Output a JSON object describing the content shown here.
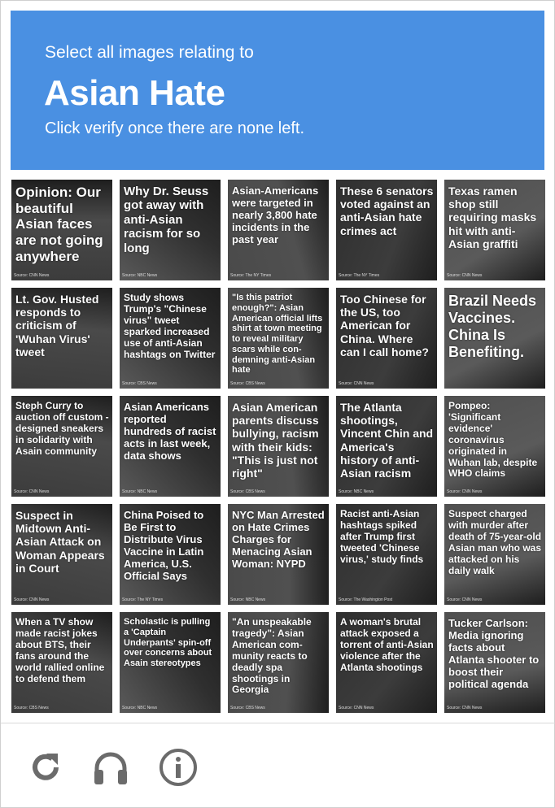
{
  "header": {
    "pre": "Select all images relating to",
    "topic": "Asian Hate",
    "post": "Click verify once there are none left."
  },
  "tiles": [
    {
      "headline": "Opinion: Our beautiful Asian faces are not going anywhere",
      "source": "Source: CNN News",
      "size": 17
    },
    {
      "headline": "Why Dr. Seuss got away with anti-Asian racism for so long",
      "source": "Source: NBC News",
      "size": 15
    },
    {
      "headline": "Asian-Americans were targeted in nearly 3,800 hate incidents in the past year",
      "source": "Source: The NY Times",
      "size": 13
    },
    {
      "headline": "These 6 senators voted against an anti-Asian hate crimes act",
      "source": "Source: The NY Times",
      "size": 14
    },
    {
      "headline": "Texas ramen shop still requiring masks hit with anti-Asian graffiti",
      "source": "Source: CNN News",
      "size": 14
    },
    {
      "headline": "Lt. Gov. Husted responds to criticism of 'Wuhan Virus' tweet",
      "source": "",
      "size": 14
    },
    {
      "headline": "Study shows Trump's \"Chinese virus\" tweet sparked increased use of anti-Asian hashtags on Twitter",
      "source": "Source: CBS News",
      "size": 12
    },
    {
      "headline": "\"Is this patriot enough?\": Asian American official lifts shirt at town meeting to reveal military scars while con-demning anti-Asian hate",
      "source": "Source: CBS News",
      "size": 11
    },
    {
      "headline": "Too Chinese for the US, too American for China. Where can I call home?",
      "source": "Source: CNN News",
      "size": 14
    },
    {
      "headline": "Brazil Needs Vaccines. China Is Benefiting.",
      "source": "",
      "size": 18
    },
    {
      "headline": "Steph Curry to auction off custom -designed sneakers in solidarity with Asain community",
      "source": "Source: CNN News",
      "size": 12
    },
    {
      "headline": "Asian Americans reported hundreds of racist acts in last week, data shows",
      "source": "Source: NBC News",
      "size": 13
    },
    {
      "headline": "Asian American parents discuss bullying, racism with their kids: \"This is just not right\"",
      "source": "Source: CBS News",
      "size": 14
    },
    {
      "headline": "The Atlanta shootings, Vincent Chin and America's history of anti-Asian racism",
      "source": "Source: NBC News",
      "size": 14
    },
    {
      "headline": "Pompeo: 'Significant evidence' coronavirus originated in Wuhan lab, despite WHO claims",
      "source": "Source: CNN News",
      "size": 12
    },
    {
      "headline": "Suspect in Midtown Anti-Asian Attack on Woman Appears in Court",
      "source": "Source: CNN News",
      "size": 14
    },
    {
      "headline": "China Poised to Be First to Distribute Virus Vaccine in Latin America, U.S. Official Says",
      "source": "Source: The NY Times",
      "size": 13
    },
    {
      "headline": "NYC Man Arrested on Hate Crimes Charges for Menacing Asian Woman: NYPD",
      "source": "Source: NBC News",
      "size": 13
    },
    {
      "headline": "Racist anti-Asian hashtags spiked after Trump first tweeted 'Chinese virus,' study finds",
      "source": "Source: The Washington Post",
      "size": 12
    },
    {
      "headline": "Suspect charged with murder after death of 75-year-old Asian man who was attacked on his daily walk",
      "source": "Source: CNN News",
      "size": 12
    },
    {
      "headline": "When a TV show made racist jokes about BTS, their fans around the world rallied online to defend them",
      "source": "Source: CBS News",
      "size": 12
    },
    {
      "headline": "Scholastic is pulling a 'Captain Underpants' spin-off over concerns about Asain stereotypes",
      "source": "Source: NBC News",
      "size": 11
    },
    {
      "headline": "\"An unspeakable tragedy\": Asian American com-munity reacts to deadly spa shootings in Georgia",
      "source": "Source: CBS News",
      "size": 12
    },
    {
      "headline": "A woman's brutal attack exposed a torrent of anti-Asian violence after the Atlanta shootings",
      "source": "Source: CNN News",
      "size": 12
    },
    {
      "headline": "Tucker Carlson: Media ignoring facts about Atlanta shooter to boost their political agenda",
      "source": "Source: CNN News",
      "size": 13
    }
  ],
  "footer": {
    "reload_icon": "reload-icon",
    "audio_icon": "headphones-icon",
    "info_icon": "info-icon"
  }
}
